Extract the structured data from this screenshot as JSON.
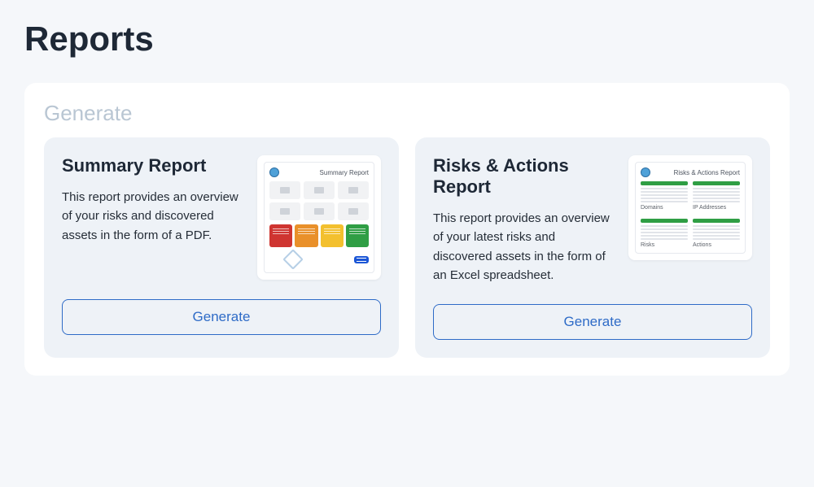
{
  "page": {
    "title": "Reports"
  },
  "panel": {
    "title": "Generate"
  },
  "cards": {
    "summary": {
      "title": "Summary Report",
      "description": "This report provides an overview of your risks and discovered assets in the form of a PDF.",
      "preview_title": "Summary Report",
      "preview_tile_colors": [
        "#cf3531",
        "#e9902a",
        "#f3c02e",
        "#2f9e44"
      ],
      "button": "Generate"
    },
    "risks": {
      "title": "Risks & Actions Report",
      "description": "This report provides an overview of your latest risks and discovered assets in the form of an Excel spreadsheet.",
      "preview_title": "Risks & Actions Report",
      "preview_section_labels": [
        "Domains",
        "IP Addresses",
        "Risks",
        "Actions"
      ],
      "button": "Generate"
    }
  },
  "colors": {
    "accent": "#2e6bc7",
    "page_bg": "#f5f7fa",
    "card_bg": "#eef2f7",
    "muted_heading": "#b9c6d3"
  }
}
